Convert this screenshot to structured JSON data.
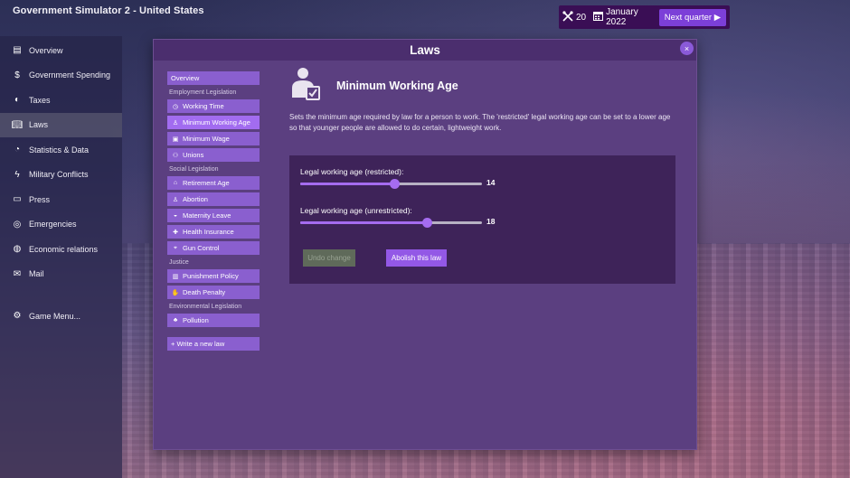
{
  "app": {
    "title": "Government Simulator 2 - United States"
  },
  "topbar": {
    "points": "20",
    "points_icon": "tools-icon",
    "date": "January 2022",
    "date_icon": "calendar-icon",
    "next_label": "Next quarter ▶"
  },
  "sidebar": {
    "items": [
      {
        "label": "Overview",
        "icon": "overview-icon"
      },
      {
        "label": "Government Spending",
        "icon": "dollar-icon"
      },
      {
        "label": "Taxes",
        "icon": "tax-icon"
      },
      {
        "label": "Laws",
        "icon": "book-icon"
      },
      {
        "label": "Statistics & Data",
        "icon": "chart-icon"
      },
      {
        "label": "Military Conflicts",
        "icon": "lightning-icon"
      },
      {
        "label": "Press",
        "icon": "newspaper-icon"
      },
      {
        "label": "Emergencies",
        "icon": "alert-icon"
      },
      {
        "label": "Economic relations",
        "icon": "globe-icon"
      },
      {
        "label": "Mail",
        "icon": "mail-icon"
      },
      {
        "label": "Game Menu...",
        "icon": "gear-icon"
      }
    ]
  },
  "laws_window": {
    "title": "Laws",
    "close": "×"
  },
  "law_nav": {
    "overview": "Overview",
    "cat_employment": "Employment Legislation",
    "employment": [
      "Working Time",
      "Minimum Working Age",
      "Minimum Wage",
      "Unions"
    ],
    "cat_social": "Social Legislation",
    "social": [
      "Retirement Age",
      "Abortion",
      "Maternity Leave",
      "Health Insurance",
      "Gun Control"
    ],
    "cat_justice": "Justice",
    "justice": [
      "Punishment Policy",
      "Death Penalty"
    ],
    "cat_environmental": "Environmental Legislation",
    "environmental": [
      "Pollution"
    ],
    "write_new": "+ Write a new law"
  },
  "law": {
    "title": "Minimum Working Age",
    "icon": "worker-check-icon",
    "description": "Sets the minimum age required by law for a person to work. The 'restricted' legal working age can be set to a lower age so that younger people are allowed to do certain, lightweight work.",
    "sliders": [
      {
        "label": "Legal working age (restricted):",
        "value": "14",
        "fraction": 0.52
      },
      {
        "label": "Legal working age (unrestricted):",
        "value": "18",
        "fraction": 0.7
      }
    ],
    "undo_label": "Undo change",
    "abolish_label": "Abolish this law"
  },
  "colors": {
    "accent": "#a56cf0",
    "topbar_bg": "#3a0e55",
    "window_bg": "#5b3f80",
    "panel_bg": "#3e2359"
  }
}
